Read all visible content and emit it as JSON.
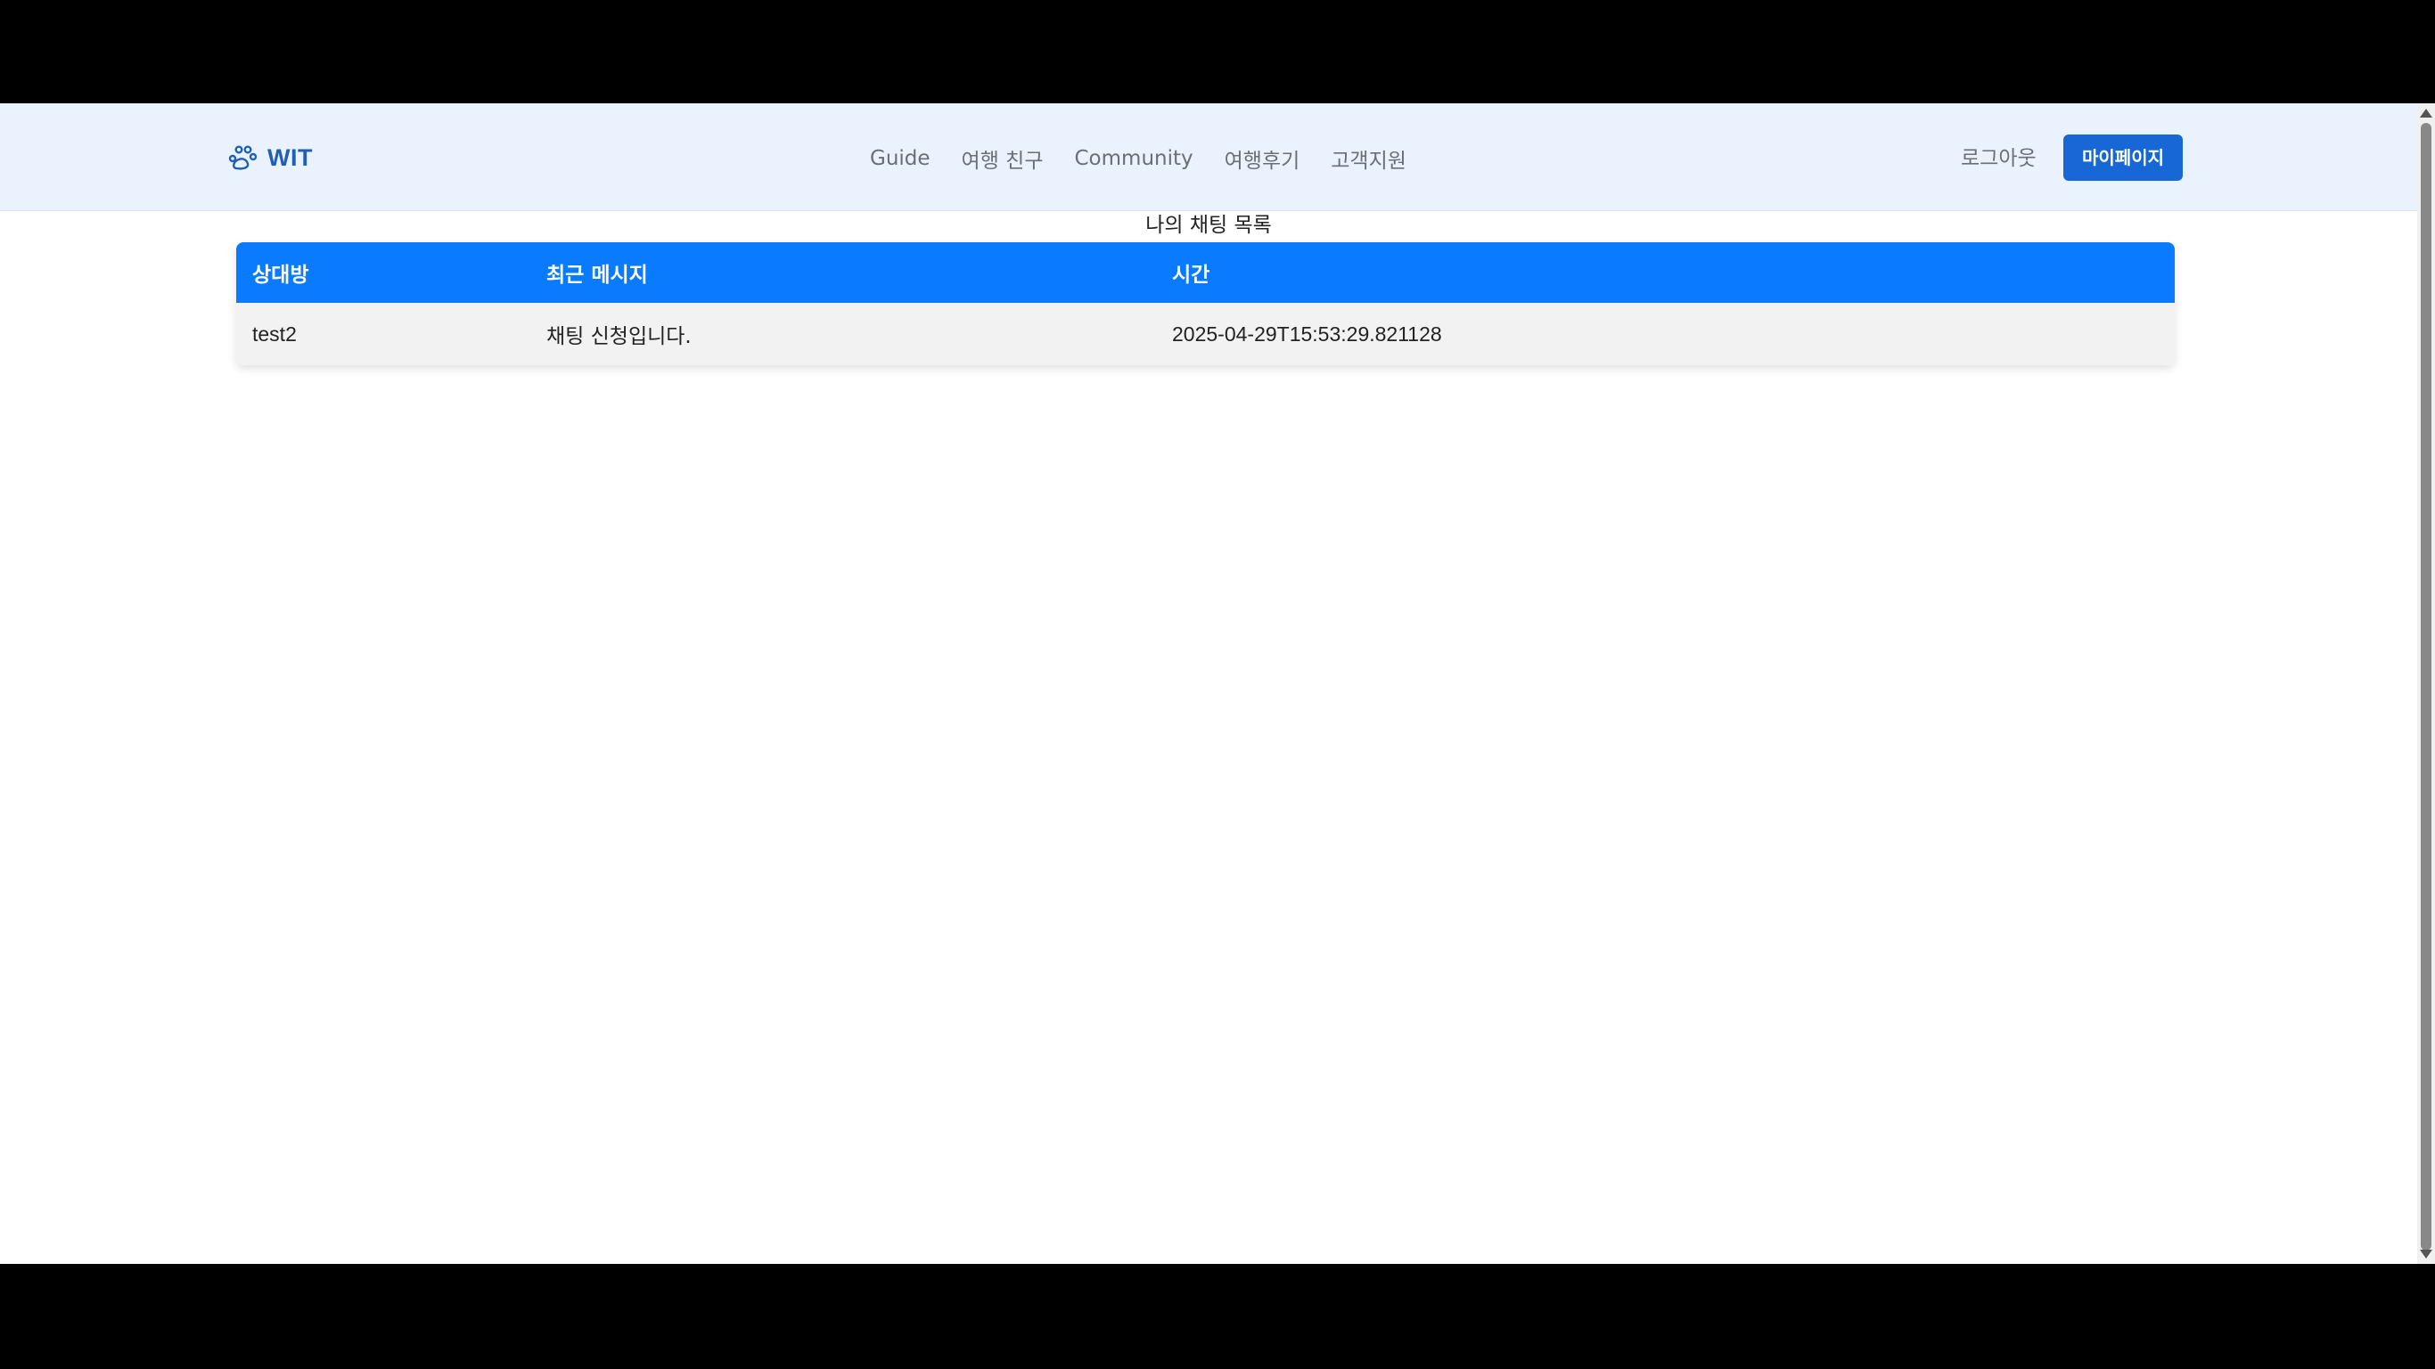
{
  "header": {
    "logo_text": "WIT",
    "nav": [
      "Guide",
      "여행 친구",
      "Community",
      "여행후기",
      "고객지원"
    ],
    "logout_label": "로그아웃",
    "mypage_label": "마이페이지"
  },
  "main": {
    "title": "나의 채팅 목록",
    "table": {
      "columns": [
        "상대방",
        "최근 메시지",
        "시간"
      ],
      "rows": [
        {
          "user": "test2",
          "message": "채팅 신청입니다.",
          "time": "2025-04-29T15:53:29.821128"
        }
      ]
    }
  },
  "colors": {
    "header_bg": "#eaf3fd",
    "brand": "#1f5fb5",
    "table_header": "#0a7bff",
    "button": "#1768d6"
  },
  "icons": {
    "logo": "paw-icon"
  }
}
